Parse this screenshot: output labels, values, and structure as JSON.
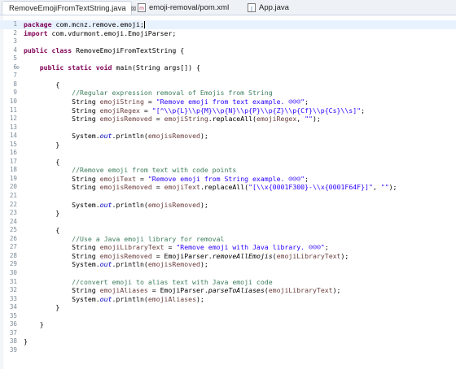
{
  "tabs": [
    {
      "label": "RemoveEmojiFromTextString.java",
      "close": "⊠",
      "active": true,
      "icon": "java-file-icon"
    },
    {
      "label": "emoji-removal/pom.xml",
      "close": "",
      "active": false,
      "icon": "maven-pom-icon"
    },
    {
      "label": "App.java",
      "close": "",
      "active": false,
      "icon": "java-file-icon"
    }
  ],
  "colors": {
    "keyword": "#7f0055",
    "string": "#2a00ff",
    "comment": "#3f7f5f",
    "field": "#0000c0",
    "variable": "#6a3e3e",
    "line_number": "#7a8a99",
    "current_line": "#e8f2fe"
  },
  "lines": [
    {
      "n": "1",
      "tokens": [
        [
          "kw",
          "package"
        ],
        [
          "plain",
          " com.mcnz.remove.emoji;"
        ]
      ],
      "caret": true,
      "current": true
    },
    {
      "n": "2",
      "tokens": [
        [
          "kw",
          "import"
        ],
        [
          "plain",
          " com.vdurmont.emoji.EmojiParser;"
        ]
      ]
    },
    {
      "n": "3",
      "tokens": []
    },
    {
      "n": "4",
      "tokens": [
        [
          "kw",
          "public"
        ],
        [
          "plain",
          " "
        ],
        [
          "kw",
          "class"
        ],
        [
          "plain",
          " RemoveEmojiFromTextString {"
        ]
      ]
    },
    {
      "n": "5",
      "tokens": []
    },
    {
      "n": "6",
      "fold": "⊖",
      "tokens": [
        [
          "plain",
          "    "
        ],
        [
          "kw",
          "public"
        ],
        [
          "plain",
          " "
        ],
        [
          "kw",
          "static"
        ],
        [
          "plain",
          " "
        ],
        [
          "kw",
          "void"
        ],
        [
          "plain",
          " main(String args[]) {"
        ]
      ]
    },
    {
      "n": "7",
      "tokens": []
    },
    {
      "n": "8",
      "tokens": [
        [
          "plain",
          "        {"
        ]
      ]
    },
    {
      "n": "9",
      "tokens": [
        [
          "plain",
          "            "
        ],
        [
          "cm",
          "//Regular expression removal of Emojis from String"
        ]
      ]
    },
    {
      "n": "10",
      "tokens": [
        [
          "plain",
          "            String "
        ],
        [
          "var",
          "emojiString"
        ],
        [
          "plain",
          " = "
        ],
        [
          "str",
          "\"Remove emoji from text example. ☺☺☺\""
        ],
        [
          "plain",
          ";"
        ]
      ]
    },
    {
      "n": "11",
      "tokens": [
        [
          "plain",
          "            String "
        ],
        [
          "var",
          "emojiRegex"
        ],
        [
          "plain",
          " = "
        ],
        [
          "str",
          "\"[^\\\\p{L}\\\\p{M}\\\\p{N}\\\\p{P}\\\\p{Z}\\\\p{Cf}\\\\p{Cs}\\\\s]\""
        ],
        [
          "plain",
          ";"
        ]
      ]
    },
    {
      "n": "12",
      "tokens": [
        [
          "plain",
          "            String "
        ],
        [
          "var",
          "emojisRemoved"
        ],
        [
          "plain",
          " = "
        ],
        [
          "var",
          "emojiString"
        ],
        [
          "plain",
          ".replaceAll("
        ],
        [
          "var",
          "emojiRegex"
        ],
        [
          "plain",
          ", "
        ],
        [
          "str",
          "\"\""
        ],
        [
          "plain",
          ");"
        ]
      ]
    },
    {
      "n": "13",
      "tokens": []
    },
    {
      "n": "14",
      "tokens": [
        [
          "plain",
          "            System."
        ],
        [
          "fld",
          "out"
        ],
        [
          "plain",
          ".println("
        ],
        [
          "var",
          "emojisRemoved"
        ],
        [
          "plain",
          ");"
        ]
      ]
    },
    {
      "n": "15",
      "tokens": [
        [
          "plain",
          "        }"
        ]
      ]
    },
    {
      "n": "16",
      "tokens": []
    },
    {
      "n": "17",
      "tokens": [
        [
          "plain",
          "        {"
        ]
      ]
    },
    {
      "n": "18",
      "tokens": [
        [
          "plain",
          "            "
        ],
        [
          "cm",
          "//Remove emoji from text with code points"
        ]
      ]
    },
    {
      "n": "19",
      "tokens": [
        [
          "plain",
          "            String "
        ],
        [
          "var",
          "emojiText"
        ],
        [
          "plain",
          " = "
        ],
        [
          "str",
          "\"Remove emoji from String example. ☺☺☺\""
        ],
        [
          "plain",
          ";"
        ]
      ]
    },
    {
      "n": "20",
      "tokens": [
        [
          "plain",
          "            String "
        ],
        [
          "var",
          "emojisRemoved"
        ],
        [
          "plain",
          " = "
        ],
        [
          "var",
          "emojiText"
        ],
        [
          "plain",
          ".replaceAll("
        ],
        [
          "str",
          "\"[\\\\x{0001F300}-\\\\x{0001F64F}]\""
        ],
        [
          "plain",
          ", "
        ],
        [
          "str",
          "\"\""
        ],
        [
          "plain",
          ");"
        ]
      ]
    },
    {
      "n": "21",
      "tokens": []
    },
    {
      "n": "22",
      "tokens": [
        [
          "plain",
          "            System."
        ],
        [
          "fld",
          "out"
        ],
        [
          "plain",
          ".println("
        ],
        [
          "var",
          "emojisRemoved"
        ],
        [
          "plain",
          ");"
        ]
      ]
    },
    {
      "n": "23",
      "tokens": [
        [
          "plain",
          "        }"
        ]
      ]
    },
    {
      "n": "24",
      "tokens": []
    },
    {
      "n": "25",
      "tokens": [
        [
          "plain",
          "        {"
        ]
      ]
    },
    {
      "n": "26",
      "tokens": [
        [
          "plain",
          "            "
        ],
        [
          "cm",
          "//Use a Java emoji library for removal"
        ]
      ]
    },
    {
      "n": "27",
      "tokens": [
        [
          "plain",
          "            String "
        ],
        [
          "var",
          "emojiLibraryText"
        ],
        [
          "plain",
          " = "
        ],
        [
          "str",
          "\"Remove emoji with Java library. ☺☺☺\""
        ],
        [
          "plain",
          ";"
        ]
      ]
    },
    {
      "n": "28",
      "tokens": [
        [
          "plain",
          "            String "
        ],
        [
          "var",
          "emojisRemoved"
        ],
        [
          "plain",
          " = EmojiParser."
        ],
        [
          "mth",
          "removeAllEmojis"
        ],
        [
          "plain",
          "("
        ],
        [
          "var",
          "emojiLibraryText"
        ],
        [
          "plain",
          ");"
        ]
      ]
    },
    {
      "n": "29",
      "tokens": [
        [
          "plain",
          "            System."
        ],
        [
          "fld",
          "out"
        ],
        [
          "plain",
          ".println("
        ],
        [
          "var",
          "emojisRemoved"
        ],
        [
          "plain",
          ");"
        ]
      ]
    },
    {
      "n": "30",
      "tokens": []
    },
    {
      "n": "31",
      "tokens": [
        [
          "plain",
          "            "
        ],
        [
          "cm",
          "//convert emoji to alias text with Java emoji code"
        ]
      ]
    },
    {
      "n": "32",
      "tokens": [
        [
          "plain",
          "            String "
        ],
        [
          "var",
          "emojiAliases"
        ],
        [
          "plain",
          " = EmojiParser."
        ],
        [
          "mth",
          "parseToAliases"
        ],
        [
          "plain",
          "("
        ],
        [
          "var",
          "emojiLibraryText"
        ],
        [
          "plain",
          ");"
        ]
      ]
    },
    {
      "n": "33",
      "tokens": [
        [
          "plain",
          "            System."
        ],
        [
          "fld",
          "out"
        ],
        [
          "plain",
          ".println("
        ],
        [
          "var",
          "emojiAliases"
        ],
        [
          "plain",
          ");"
        ]
      ]
    },
    {
      "n": "34",
      "tokens": [
        [
          "plain",
          "        }"
        ]
      ]
    },
    {
      "n": "35",
      "tokens": []
    },
    {
      "n": "36",
      "tokens": [
        [
          "plain",
          "    }"
        ]
      ]
    },
    {
      "n": "37",
      "tokens": []
    },
    {
      "n": "38",
      "tokens": [
        [
          "plain",
          "}"
        ]
      ]
    },
    {
      "n": "39",
      "tokens": []
    }
  ]
}
